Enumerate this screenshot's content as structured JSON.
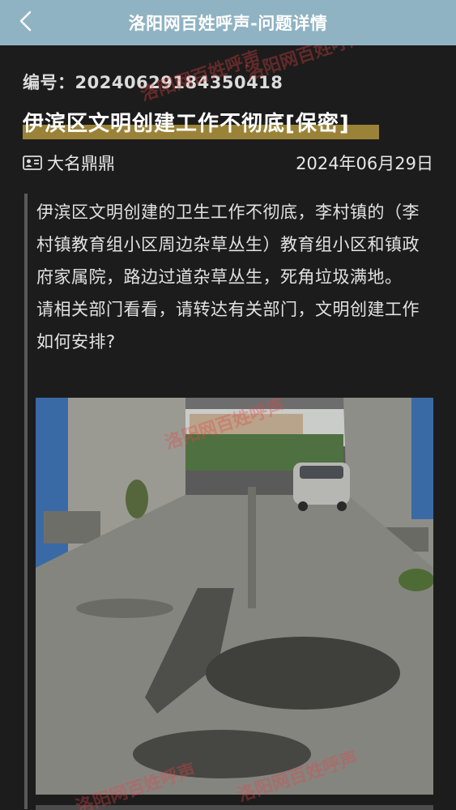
{
  "header": {
    "title": "洛阳网百姓呼声-问题详情",
    "back_icon": "chevron-left-icon"
  },
  "post": {
    "ticket_label": "编号：",
    "ticket_number": "20240629184350418",
    "title": "伊滨区文明创建工作不彻底[保密]",
    "author": "大名鼎鼎",
    "author_icon": "id-card-icon",
    "date": "2024年06月29日",
    "body": "伊滨区文明创建的卫生工作不彻底，李村镇的（李村镇教育组小区周边杂草丛生）教育组小区和镇政府家属院，路边过道杂草丛生，死角垃圾满地。\n请相关部门看看，请转达有关部门，文明创建工作如何安排?"
  },
  "watermark": {
    "text": "百姓呼声",
    "brand": "洛阳网"
  },
  "colors": {
    "header_bg": "#8fb3c2",
    "page_bg": "#1c1c1c",
    "title_highlight": "#a98f3c"
  }
}
